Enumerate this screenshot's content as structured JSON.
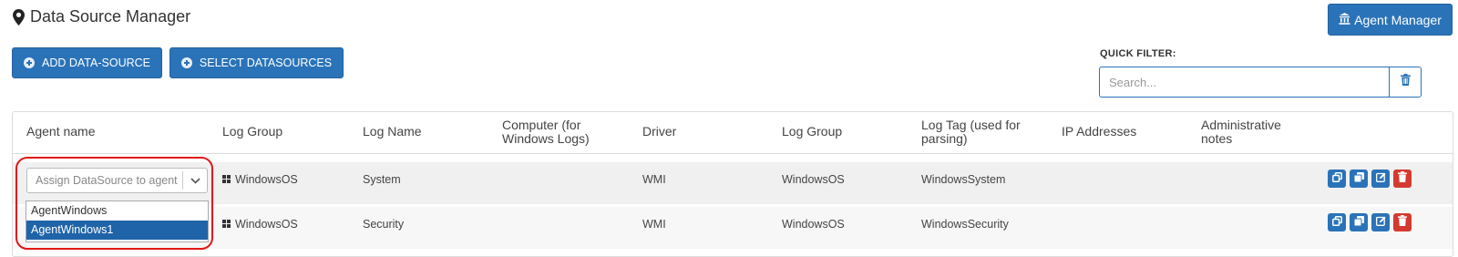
{
  "page": {
    "title": "Data Source Manager",
    "title_icon": "map-marker-icon"
  },
  "toolbar": {
    "agent_manager_label": "Agent Manager",
    "agent_manager_icon": "building-icon",
    "add_datasource_label": "ADD DATA-SOURCE",
    "select_datasources_label": "SELECT DATASOURCES",
    "button_icon": "plus-circle-icon"
  },
  "quick_filter": {
    "label": "QUICK FILTER:",
    "placeholder": "Search...",
    "clear_icon": "trash-icon"
  },
  "table": {
    "headers": [
      "Agent name",
      "Log Group",
      "Log Name",
      "Computer (for Windows Logs)",
      "Driver",
      "Log Group",
      "Log Tag (used for parsing)",
      "IP Addresses",
      "Administrative notes"
    ],
    "rows": [
      {
        "agent": "Assign DataSource to agent",
        "log_group": "WindowsOS",
        "log_group_icon": "windows-icon",
        "log_name": "System",
        "computer": "",
        "driver": "WMI",
        "log_group2": "WindowsOS",
        "log_tag": "WindowsSystem",
        "ip": "",
        "notes": ""
      },
      {
        "agent": "",
        "log_group": "WindowsOS",
        "log_group_icon": "windows-icon",
        "log_name": "Security",
        "computer": "",
        "driver": "WMI",
        "log_group2": "WindowsOS",
        "log_tag": "WindowsSecurity",
        "ip": "",
        "notes": ""
      }
    ],
    "row_actions": [
      "clone-icon",
      "copy-icon",
      "edit-icon",
      "delete-icon"
    ]
  },
  "agent_dropdown": {
    "placeholder": "Assign DataSource to agent",
    "options": [
      "AgentWindows",
      "AgentWindows1"
    ],
    "highlighted": "AgentWindows1"
  },
  "colors": {
    "primary": "#2a73b8",
    "danger": "#d43a2f",
    "highlight_ring": "#e01818",
    "selected_option": "#1f64a8"
  }
}
